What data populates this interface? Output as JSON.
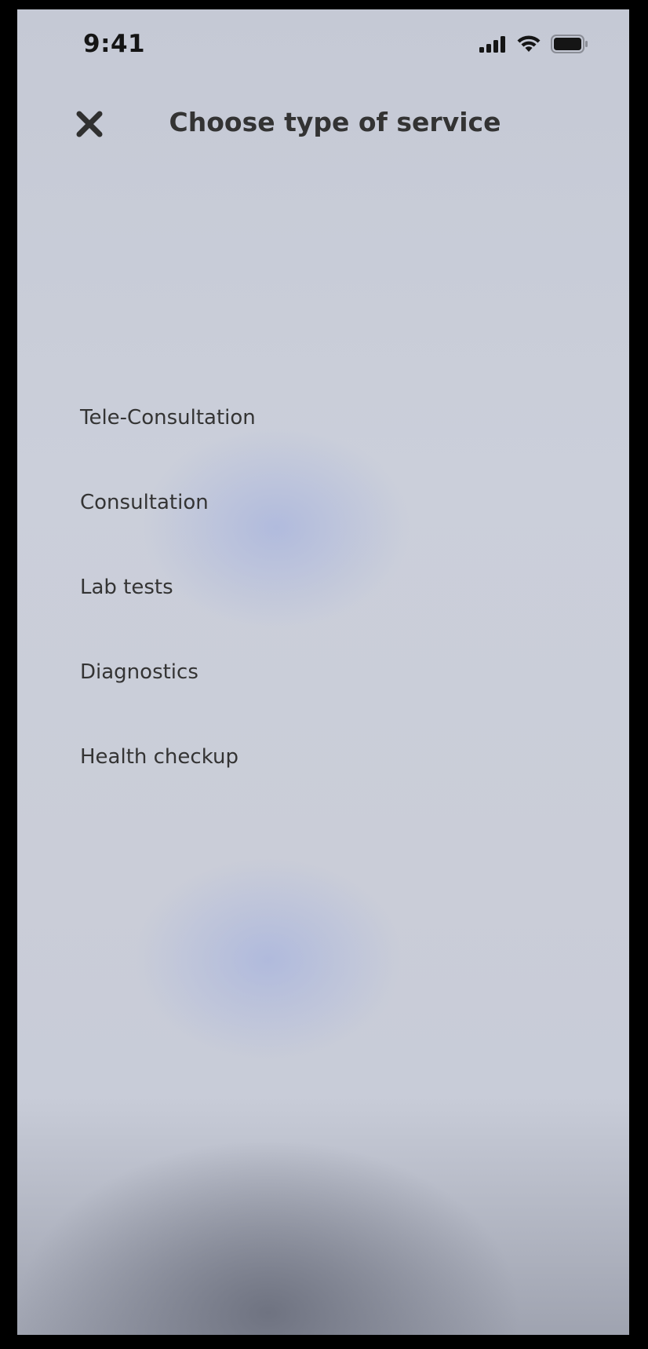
{
  "status_bar": {
    "time": "9:41",
    "icons": [
      "signal-icon",
      "wifi-icon",
      "battery-icon"
    ]
  },
  "header": {
    "title": "Choose type of service",
    "close_icon": "close-icon"
  },
  "services": [
    {
      "label": "Tele-Consultation"
    },
    {
      "label": "Consultation"
    },
    {
      "label": "Lab tests"
    },
    {
      "label": "Diagnostics"
    },
    {
      "label": "Health checkup"
    }
  ],
  "colors": {
    "text": "#343434",
    "title": "#333333",
    "background": "#c9cdd8",
    "accent_glow": "#a8b4de"
  }
}
